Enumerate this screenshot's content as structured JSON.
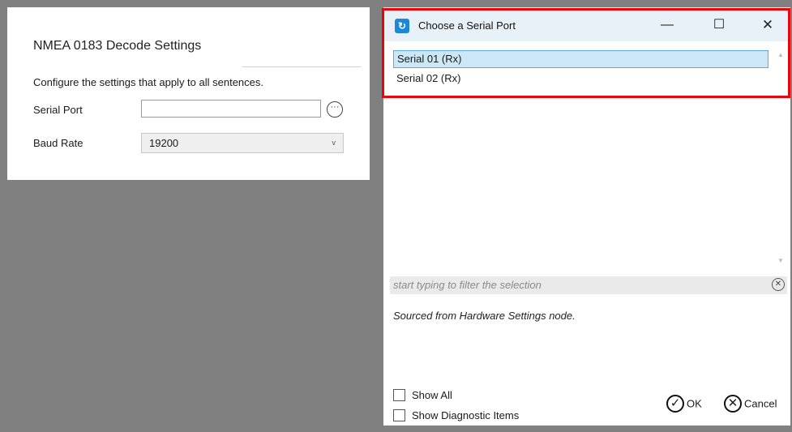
{
  "settings_panel": {
    "title": "NMEA 0183 Decode Settings",
    "description": "Configure the settings that apply to all sentences.",
    "serial_port_label": "Serial Port",
    "serial_port_value": "",
    "baud_rate_label": "Baud Rate",
    "baud_rate_value": "19200"
  },
  "dialog": {
    "title": "Choose a Serial Port",
    "items": [
      {
        "label": "Serial 01 (Rx)",
        "selected": true
      },
      {
        "label": "Serial 02 (Rx)",
        "selected": false
      }
    ],
    "filter_placeholder": "start typing to filter the selection",
    "source_note": "Sourced from Hardware Settings node.",
    "checkboxes": [
      {
        "label": "Show All",
        "checked": false
      },
      {
        "label": "Show Diagnostic Items",
        "checked": false
      }
    ],
    "ok_label": "OK",
    "cancel_label": "Cancel"
  },
  "colors": {
    "highlight": "#e8060a",
    "selection_bg": "#cce8f7",
    "background": "#808080"
  },
  "icons": {
    "browse": "ellipsis-circle-icon",
    "app": "app-logo-icon",
    "ok": "check-circle-icon",
    "cancel": "x-circle-icon"
  }
}
